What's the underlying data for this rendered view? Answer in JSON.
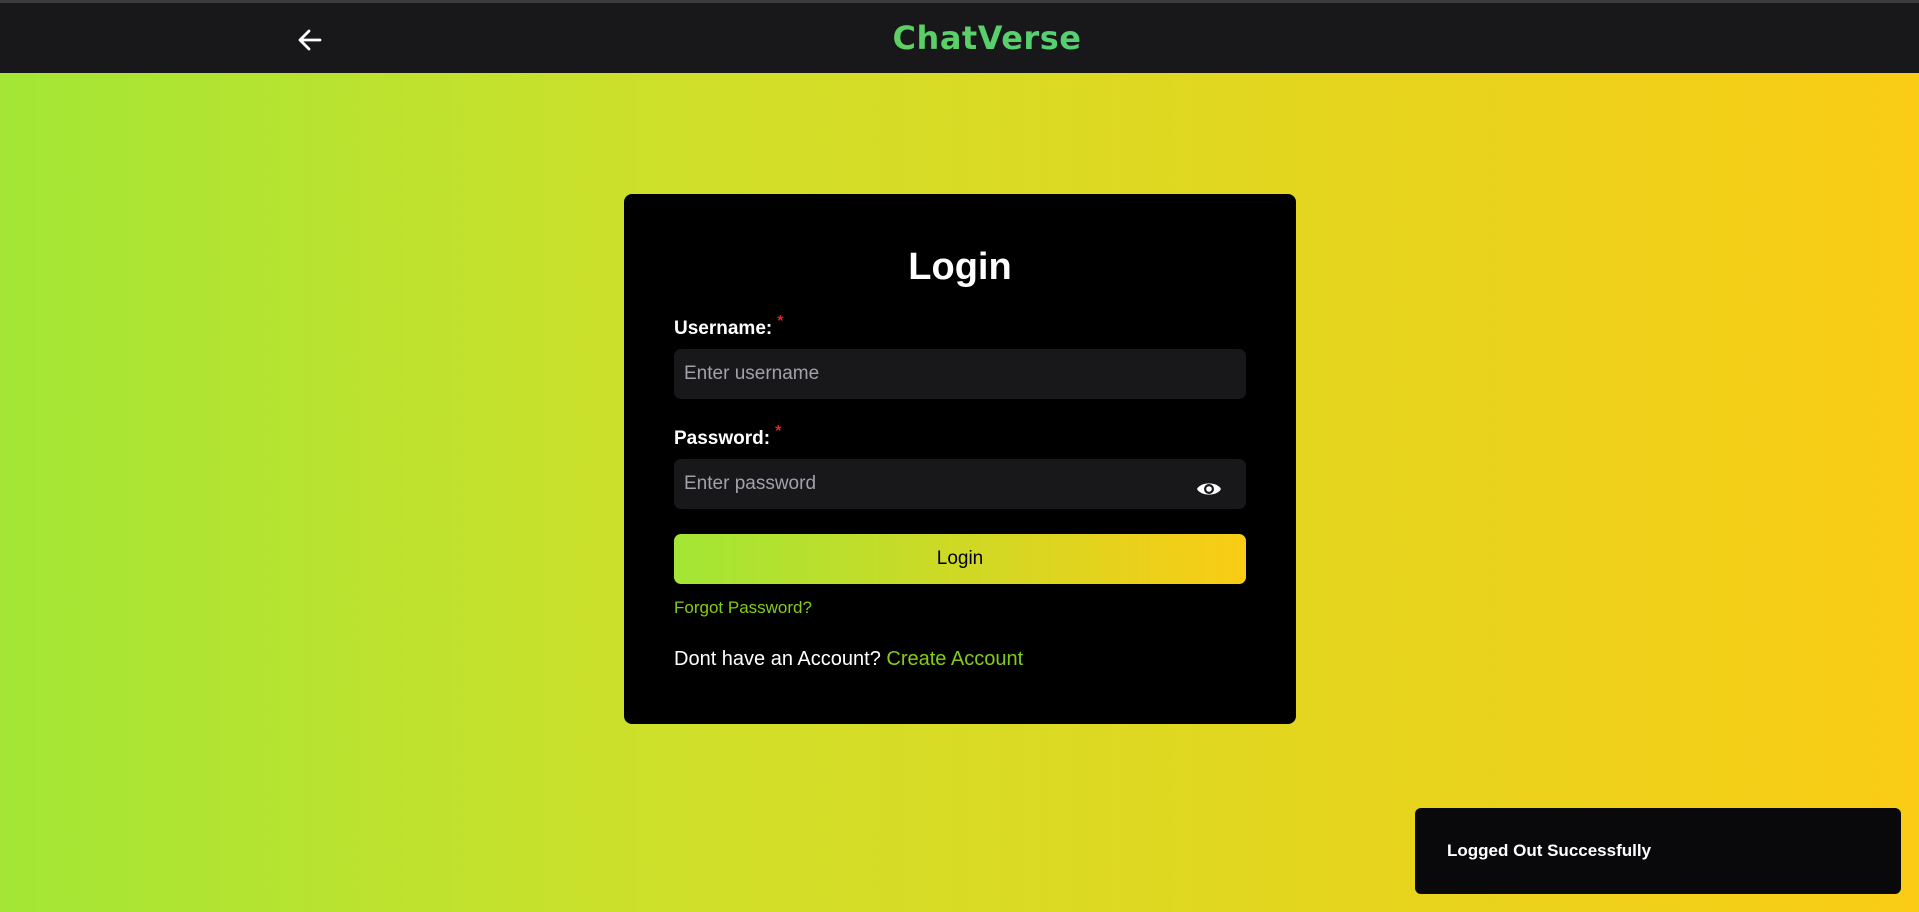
{
  "navbar": {
    "back_icon": "arrow-left-icon",
    "brand": "ChatVerse"
  },
  "login_form": {
    "title": "Login",
    "username_label": "Username:",
    "username_required_marker": "*",
    "username_placeholder": "Enter username",
    "password_label": "Password:",
    "password_required_marker": "*",
    "password_placeholder": "Enter password",
    "show_password_icon": "eye-icon",
    "submit_label": "Login",
    "forgot_password": "Forgot Password?",
    "no_account_text": "Dont have an Account?",
    "create_account": "Create Account"
  },
  "toast": {
    "message": "Logged Out Successfully"
  },
  "colors": {
    "accent_green": "#84cc16",
    "accent_yellow": "#facc15",
    "card_bg": "#000000",
    "input_bg": "#18181b",
    "required": "#dc2626"
  }
}
